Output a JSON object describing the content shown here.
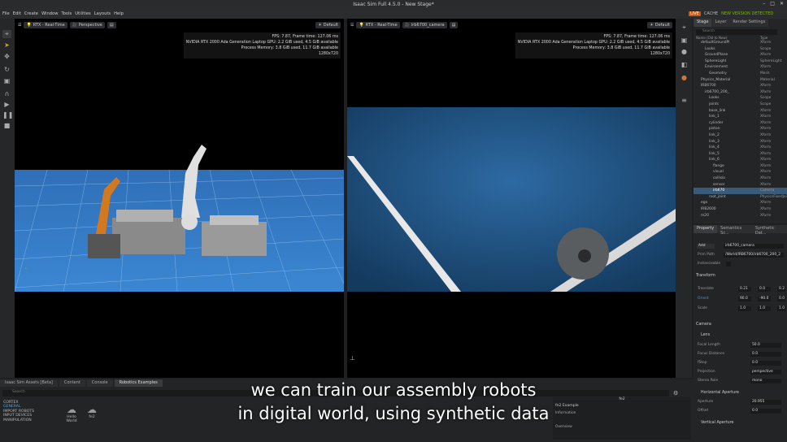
{
  "app": {
    "title": "Isaac Sim Full 4.5.0 - New Stage*"
  },
  "menu": [
    "File",
    "Edit",
    "Create",
    "Window",
    "Tools",
    "Utilities",
    "Layouts",
    "Help"
  ],
  "live": {
    "live": "LIVE",
    "cache": "CACHE",
    "new_version": "NEW VERSION DETECTED"
  },
  "vp1": {
    "render": "RTX - Real-Time",
    "camera": "Perspective",
    "mode": "Default",
    "stats": [
      "FPS: 7.87, Frame time: 127.06 ms",
      "NVIDIA RTX 2000 Ada Generation Laptop GPU: 2.2 GiB used, 4.5 GiB available",
      "Process Memory: 3.8 GiB used, 11.7 GiB available",
      "1280x720"
    ]
  },
  "vp2": {
    "render": "RTX - Real-Time",
    "camera": "irb6700_camera",
    "mode": "Default",
    "stats": [
      "FPS: 7.87, Frame time: 127.06 ms",
      "NVIDIA RTX 2000 Ada Generation Laptop GPU: 2.2 GiB used, 4.5 GiB available",
      "Process Memory: 3.8 GiB used, 11.7 GiB available",
      "1280x720"
    ]
  },
  "stage": {
    "tabs": [
      "Stage",
      "Layer",
      "Render Settings"
    ],
    "search_placeholder": "Search",
    "col_name": "Name (Old to New)",
    "col_type": "Type",
    "rows": [
      [
        "defaultGroundPl",
        "Xform"
      ],
      [
        "Looks",
        "Scope"
      ],
      [
        "GroundPlane",
        "Xform"
      ],
      [
        "SphereLight",
        "SphereLight"
      ],
      [
        "Environment",
        "Xform"
      ],
      [
        "Geometry",
        "Mesh"
      ],
      [
        "Physics_Material",
        "Material"
      ],
      [
        "IRB6700",
        "Xform"
      ],
      [
        "irb6700_200_",
        "Xform"
      ],
      [
        "Looks",
        "Scope"
      ],
      [
        "joints",
        "Scope"
      ],
      [
        "base_link",
        "Xform"
      ],
      [
        "link_1",
        "Xform"
      ],
      [
        "cylinder",
        "Xform"
      ],
      [
        "piston",
        "Xform"
      ],
      [
        "link_2",
        "Xform"
      ],
      [
        "link_3",
        "Xform"
      ],
      [
        "link_4",
        "Xform"
      ],
      [
        "link_5",
        "Xform"
      ],
      [
        "link_6",
        "Xform"
      ],
      [
        "flange",
        "Xform"
      ],
      [
        "visual",
        "Xform"
      ],
      [
        "collisio",
        "Xform"
      ],
      [
        "sensor",
        "Xform"
      ],
      [
        "irb670",
        "Camera"
      ],
      [
        "root_joint",
        "PhysicsFixedJoint"
      ],
      [
        "ego",
        "Xform"
      ],
      [
        "IRB2600",
        "Xform"
      ],
      [
        "m20",
        "Xform"
      ]
    ]
  },
  "property": {
    "tabs": [
      "Property",
      "Semantics Sc...",
      "Synthetic Dat..."
    ],
    "add": "Add",
    "name_value": "irb6700_camera",
    "prim_path_label": "Prim Path",
    "prim_path": "/World/IRB6700/irb6700_200_2",
    "instanceable": "Instanceable",
    "transform": "Transform",
    "translate": "Translate",
    "orient": "Orient",
    "scale": "Scale",
    "t_vals": [
      "0.21",
      "0.0",
      "0.2"
    ],
    "o_vals": [
      "90.0",
      "-90.0",
      "0.0"
    ],
    "s_vals": [
      "1.0",
      "1.0",
      "1.0"
    ],
    "camera": "Camera",
    "lens": "Lens",
    "focal_length": "Focal Length",
    "focal_length_v": "50.0",
    "focus_distance": "Focus Distance",
    "focus_distance_v": "0.0",
    "fstop": "fStop",
    "fstop_v": "0.0",
    "projection": "Projection",
    "projection_v": "perspective",
    "stereo": "Stereo Role",
    "stereo_v": "mono",
    "horizontal": "Horizontal Aperture",
    "aperture": "Aperture",
    "aperture_v": "20.955",
    "offset": "Offset",
    "offset_v": "0.0",
    "vertical": "Vertical Aperture"
  },
  "bottom": {
    "tabs": [
      "Isaac Sim Assets [Beta]",
      "Content",
      "Console",
      "Robotics Examples"
    ],
    "search_placeholder": "Search",
    "cats": [
      "CORTEX",
      "GENERAL",
      "IMPORT ROBOTS",
      "INPUT DEVICES",
      "MANIPULATION"
    ],
    "items": [
      {
        "label": "Hello World"
      },
      {
        "label": "fe2"
      }
    ],
    "right_title": "fe2",
    "example": "fe2 Example",
    "information": "Information",
    "overview": "Overview"
  },
  "caption": {
    "line1": "we can train our assembly robots",
    "line2": "in digital world, using synthetic data"
  },
  "colors": {
    "accent": "#76b900",
    "live": "#c85a18",
    "selection": "#3a5a7a"
  }
}
